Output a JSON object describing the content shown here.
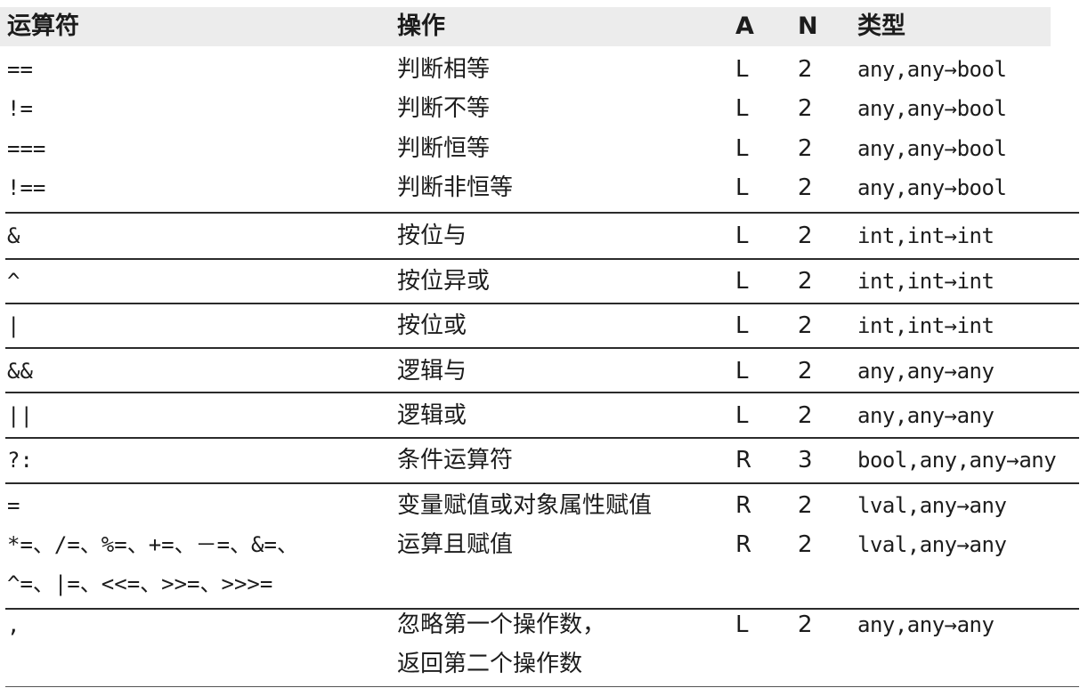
{
  "header": {
    "operator": "运算符",
    "operation": "操作",
    "a": "A",
    "n": "N",
    "type": "类型"
  },
  "rows": [
    {
      "op": "==",
      "desc": "判断相等",
      "a": "L",
      "n": "2",
      "type": "any,any→bool"
    },
    {
      "op": "!=",
      "desc": "判断不等",
      "a": "L",
      "n": "2",
      "type": "any,any→bool"
    },
    {
      "op": "===",
      "desc": "判断恒等",
      "a": "L",
      "n": "2",
      "type": "any,any→bool"
    },
    {
      "op": "!==",
      "desc": "判断非恒等",
      "a": "L",
      "n": "2",
      "type": "any,any→bool"
    },
    {
      "op": "&",
      "desc": "按位与",
      "a": "L",
      "n": "2",
      "type": "int,int→int"
    },
    {
      "op": "^",
      "desc": "按位异或",
      "a": "L",
      "n": "2",
      "type": "int,int→int"
    },
    {
      "op": "|",
      "desc": "按位或",
      "a": "L",
      "n": "2",
      "type": "int,int→int"
    },
    {
      "op": "&&",
      "desc": "逻辑与",
      "a": "L",
      "n": "2",
      "type": "any,any→any"
    },
    {
      "op": "||",
      "desc": "逻辑或",
      "a": "L",
      "n": "2",
      "type": "any,any→any"
    },
    {
      "op": "?:",
      "desc": "条件运算符",
      "a": "R",
      "n": "3",
      "type": "bool,any,any→any"
    },
    {
      "op": "=",
      "desc": "变量赋值或对象属性赋值",
      "a": "R",
      "n": "2",
      "type": "lval,any→any"
    },
    {
      "op": "*=、/=、%=、+=、－=、&=、",
      "op2": "^=、|=、<<=、>>=、>>>=",
      "desc": "运算且赋值",
      "a": "R",
      "n": "2",
      "type": "lval,any→any"
    },
    {
      "op": ",",
      "desc": "忽略第一个操作数，",
      "desc2": "返回第二个操作数",
      "a": "L",
      "n": "2",
      "type": "any,any→any"
    }
  ]
}
